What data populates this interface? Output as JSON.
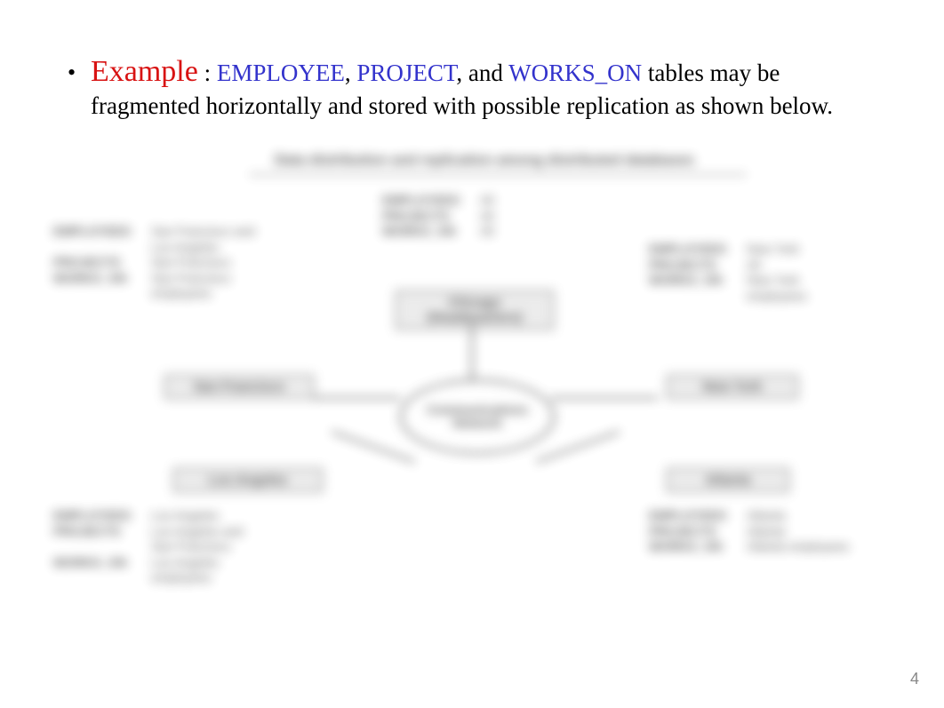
{
  "slide": {
    "bullet_leader": "•",
    "example_word": "Example",
    "colon_space": " : ",
    "table1": "EMPLOYEE",
    "sep1": ", ",
    "table2": "PROJECT",
    "sep2": ", and ",
    "table3": "WORKS_ON",
    "rest": " tables may be fragmented horizontally and stored with possible replication as shown below.",
    "page_number": "4"
  },
  "diagram": {
    "title": "Data distribution and replication among distributed databases",
    "center_node": "Communications Network",
    "hq_box": "Chicago (Headquarters)",
    "hq_list": {
      "emp_lbl": "EMPLOYEES",
      "emp_val": "All",
      "proj_lbl": "PROJECTS",
      "proj_val": "All",
      "works_lbl": "WORKS_ON",
      "works_val": "All"
    },
    "sf_box": "San Francisco",
    "sf_list": {
      "emp_lbl": "EMPLOYEES",
      "emp_val": "San Francisco and Los Angeles",
      "proj_lbl": "PROJECTS",
      "proj_val": "San Francisco",
      "works_lbl": "WORKS_ON",
      "works_val": "San Francisco employees"
    },
    "la_box": "Los Angeles",
    "la_list": {
      "emp_lbl": "EMPLOYEES",
      "emp_val": "Los Angeles",
      "proj_lbl": "PROJECTS",
      "proj_val": "Los Angeles and San Francisco",
      "works_lbl": "WORKS_ON",
      "works_val": "Los Angeles employees"
    },
    "ny_box": "New York",
    "ny_list": {
      "emp_lbl": "EMPLOYEES",
      "emp_val": "New York",
      "proj_lbl": "PROJECTS",
      "proj_val": "All",
      "works_lbl": "WORKS_ON",
      "works_val": "New York employees"
    },
    "at_box": "Atlanta",
    "at_list": {
      "emp_lbl": "EMPLOYEES",
      "emp_val": "Atlanta",
      "proj_lbl": "PROJECTS",
      "proj_val": "Atlanta",
      "works_lbl": "WORKS_ON",
      "works_val": "Atlanta employees"
    }
  }
}
